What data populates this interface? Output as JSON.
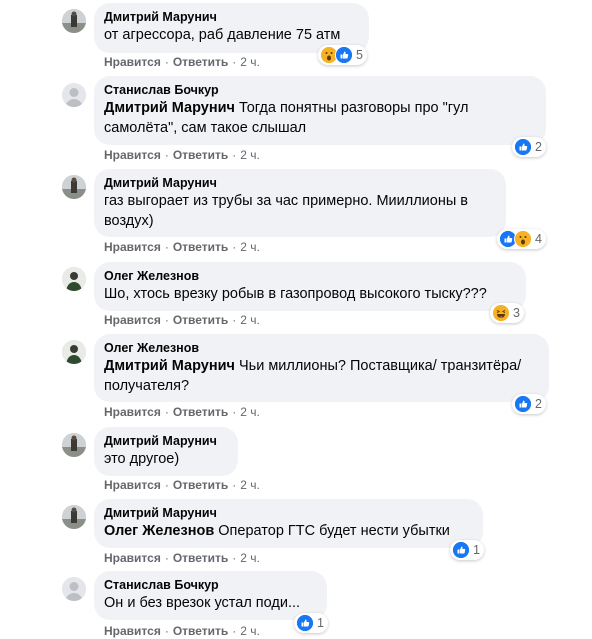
{
  "labels": {
    "like": "Нравится",
    "reply": "Ответить"
  },
  "comments": [
    {
      "author": "Дмитрий Марунич",
      "avatar": "dmitry-photo",
      "mention": "",
      "text": "от агрессора, раб давление 75 атм",
      "time": "2 ч.",
      "reactions": [
        "wow",
        "like"
      ],
      "reaction_count": "5"
    },
    {
      "author": "Станислав Бочкур",
      "avatar": "default-person",
      "mention": "Дмитрий Марунич",
      "text": "Тогда понятны разговоры про \"гул самолёта\", сам такое слышал",
      "time": "2 ч.",
      "reactions": [
        "like"
      ],
      "reaction_count": "2"
    },
    {
      "author": "Дмитрий Марунич",
      "avatar": "dmitry-photo",
      "mention": "",
      "text": "газ выгорает из трубы за час примерно. Мииллионы в воздух)",
      "time": "2 ч.",
      "reactions": [
        "like",
        "wow"
      ],
      "reaction_count": "4"
    },
    {
      "author": "Олег Железнов",
      "avatar": "oleg-photo",
      "mention": "",
      "text": "Шо, хтось врезку робыв в газопровод высокого тыску???",
      "time": "2 ч.",
      "reactions": [
        "haha"
      ],
      "reaction_count": "3"
    },
    {
      "author": "Олег Железнов",
      "avatar": "oleg-photo",
      "mention": "Дмитрий Марунич",
      "text": "Чьи миллионы? Поставщика/ транзитёра/ получателя?",
      "time": "2 ч.",
      "reactions": [
        "like"
      ],
      "reaction_count": "2"
    },
    {
      "author": "Дмитрий Марунич",
      "avatar": "dmitry-photo",
      "mention": "",
      "text": "это другое)",
      "time": "2 ч.",
      "reactions": [],
      "reaction_count": ""
    },
    {
      "author": "Дмитрий Марунич",
      "avatar": "dmitry-photo",
      "mention": "Олег Железнов",
      "text": "Оператор ГТС будет нести убытки",
      "time": "2 ч.",
      "reactions": [
        "like"
      ],
      "reaction_count": "1"
    },
    {
      "author": "Станислав Бочкур",
      "avatar": "default-person",
      "mention": "",
      "text": "Он и без врезок устал поди...",
      "time": "2 ч.",
      "reactions": [
        "like"
      ],
      "reaction_count": "1"
    }
  ]
}
